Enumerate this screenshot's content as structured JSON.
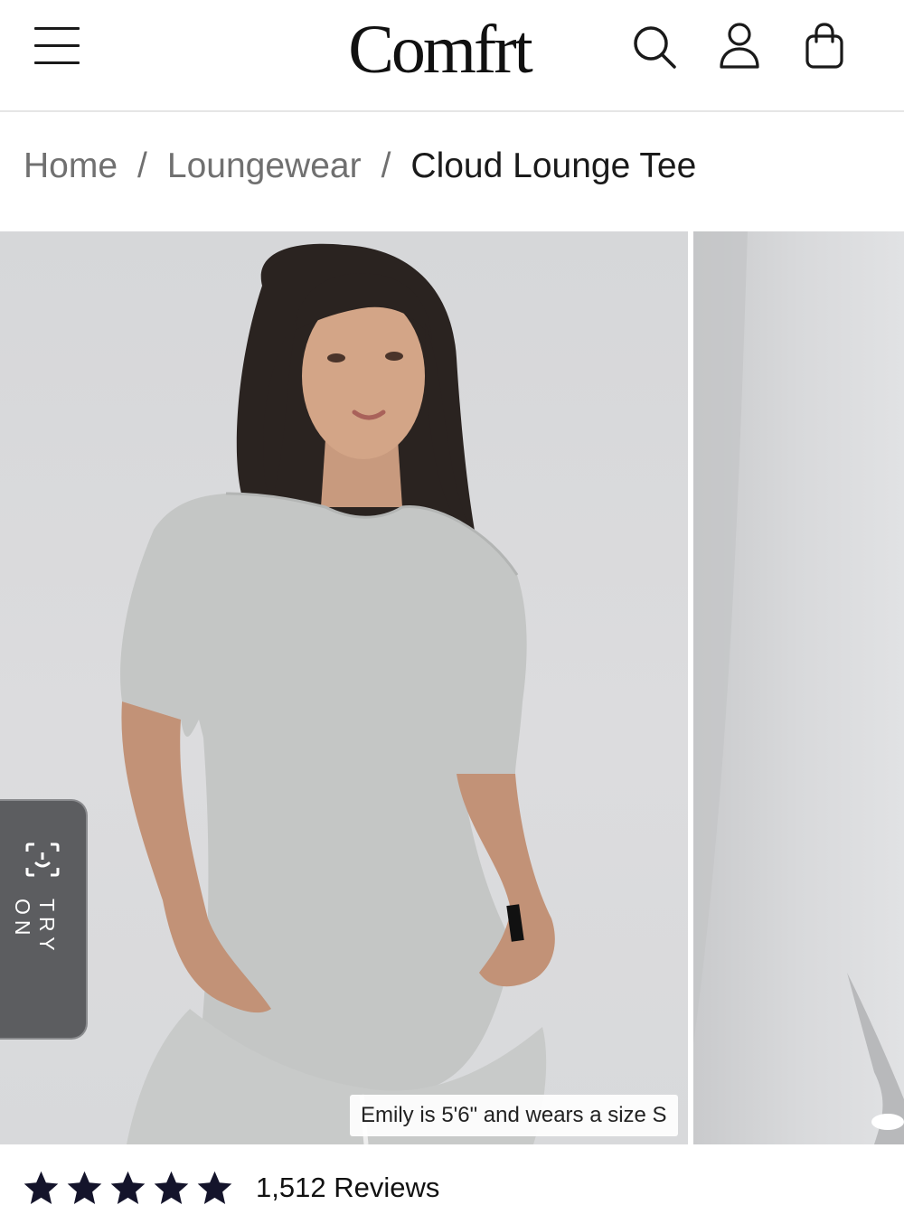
{
  "header": {
    "logo": "Comfrt",
    "icons": [
      "menu-icon",
      "search-icon",
      "account-icon",
      "shopping-bag-icon"
    ]
  },
  "breadcrumb": {
    "items": [
      {
        "label": "Home"
      },
      {
        "label": "Loungewear"
      },
      {
        "label": "Cloud Lounge Tee"
      }
    ],
    "separator": "/"
  },
  "gallery": {
    "try_on_label": "TRY ON",
    "model_caption": "Emily is 5'6\" and wears a size S"
  },
  "reviews": {
    "rating": 5,
    "max_rating": 5,
    "count_label": "1,512 Reviews"
  },
  "colors": {
    "text": "#1a1a1a",
    "muted": "#707070",
    "try_on_bg": "#5c5d60",
    "photo_bg": "#d9d9db"
  }
}
